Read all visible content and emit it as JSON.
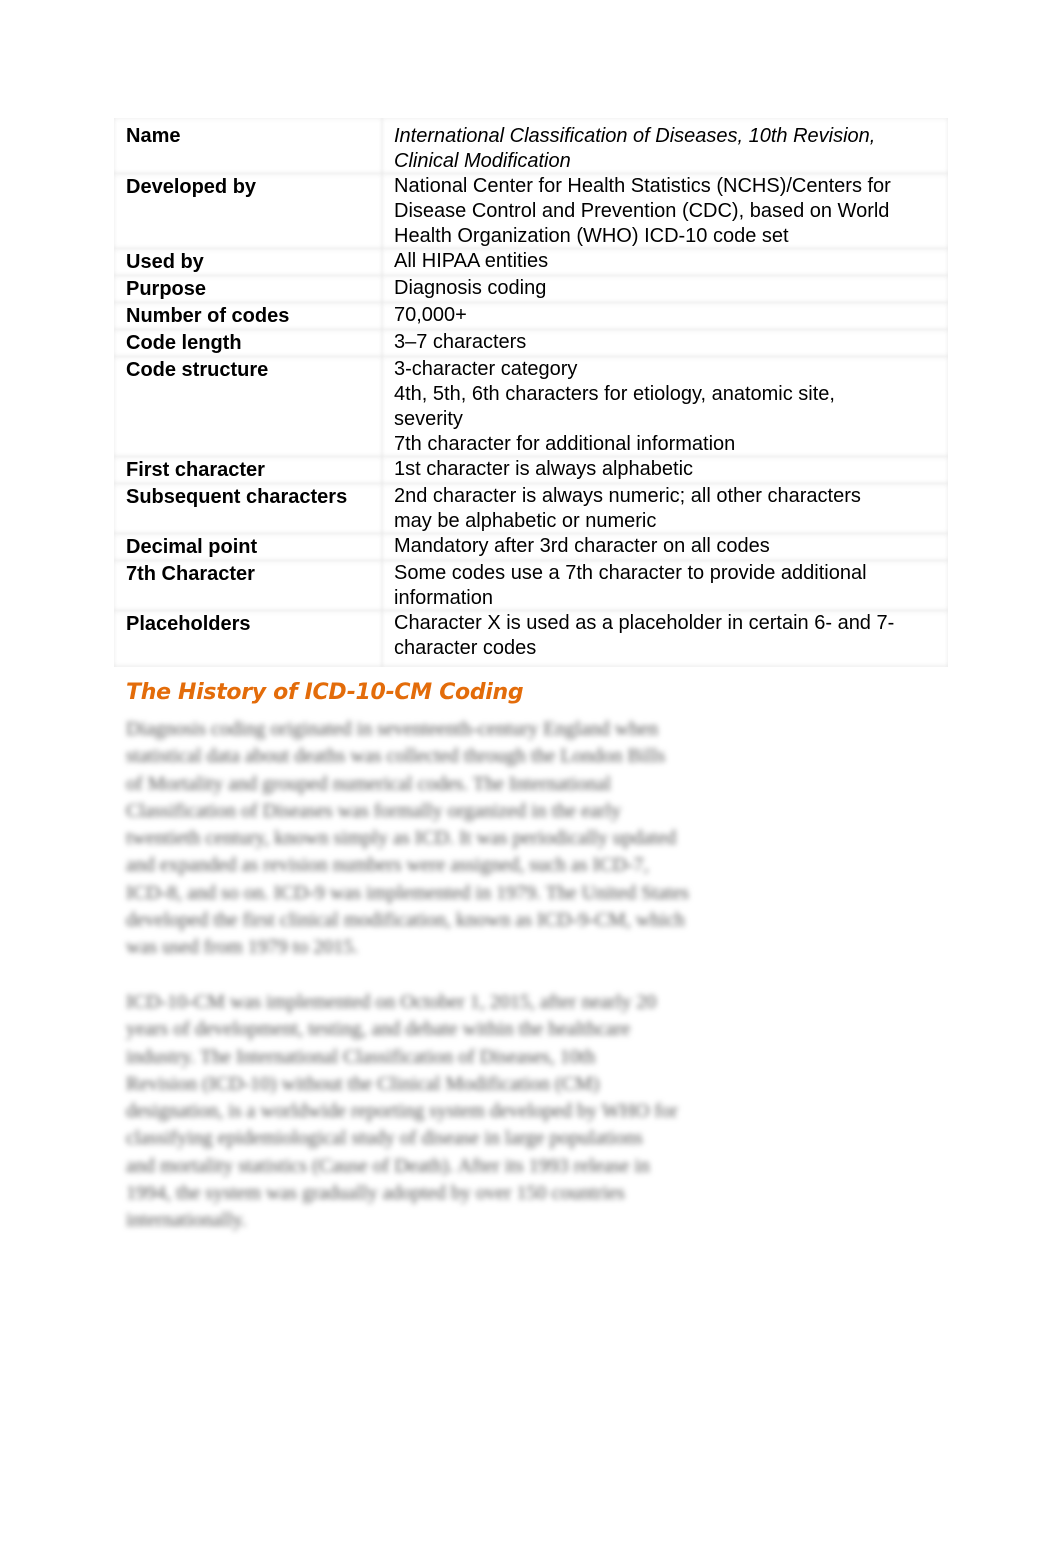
{
  "spec_table": {
    "rows": [
      {
        "key": "Name",
        "value_lines": [
          "International Classification of Diseases, 10th Revision,",
          "Clinical Modification"
        ],
        "italic": true
      },
      {
        "key": "Developed by",
        "value_lines": [
          "National Center for Health Statistics (NCHS)/Centers for",
          "Disease Control and Prevention (CDC), based on World",
          "Health Organization (WHO) ICD-10 code set"
        ]
      },
      {
        "key": "Used by",
        "value_lines": [
          "All HIPAA entities"
        ]
      },
      {
        "key": "Purpose",
        "value_lines": [
          "Diagnosis coding"
        ]
      },
      {
        "key": "Number of codes",
        "value_lines": [
          "70,000+"
        ]
      },
      {
        "key": "Code length",
        "value_lines": [
          "3–7 characters"
        ]
      },
      {
        "key": "Code structure",
        "value_lines": [
          "3-character category",
          "4th, 5th, 6th characters for etiology, anatomic site,",
          "severity",
          "7th character for additional information"
        ]
      },
      {
        "key": "First character",
        "value_lines": [
          "1st character is always alphabetic"
        ]
      },
      {
        "key": "Subsequent characters",
        "value_lines": [
          "2nd character is always numeric; all other characters",
          "may be alphabetic or numeric"
        ]
      },
      {
        "key": "Decimal point",
        "value_lines": [
          "Mandatory after 3rd character on all codes"
        ]
      },
      {
        "key": "7th Character",
        "value_lines": [
          "Some codes use a 7th character to provide additional",
          "information"
        ]
      },
      {
        "key": "Placeholders",
        "value_lines": [
          "Character X is used as a placeholder in certain 6- and 7-",
          "character codes"
        ]
      }
    ]
  },
  "section": {
    "heading": "The History of ICD-10-CM Coding",
    "heading_color": "#e36c0a",
    "paragraphs_blurred": [
      [
        "Diagnosis coding originated in seventeenth-century England when",
        "statistical data about deaths was collected through the London Bills",
        "of Mortality and grouped numerical codes. The            International",
        "Classification of Diseases        was formally organized in the early",
        "twentieth century, known simply as ICD. It was periodically updated",
        "and expanded as revision numbers were assigned, such as ICD-7,",
        "ICD-8, and so on. ICD-9 was implemented in 1979. The United States",
        "developed the first clinical modification, known as ICD-9-CM, which",
        "was used from 1979 to 2015."
      ],
      [
        "ICD-10-CM was implemented on October 1, 2015, after nearly 20",
        "years of development, testing, and debate within the healthcare",
        "industry. The      International Classification of Diseases, 10th",
        "Revision       (ICD-10)       without the Clinical Modification (CM)",
        "designation, is a worldwide reporting system developed by WHO for",
        "classifying epidemiological         study of disease in large populations",
        "and   mortality       statistics (Cause       of Death). After its 1993 release in",
        "1994, the system was gradually adopted by over 150 countries",
        "internationally."
      ]
    ]
  }
}
